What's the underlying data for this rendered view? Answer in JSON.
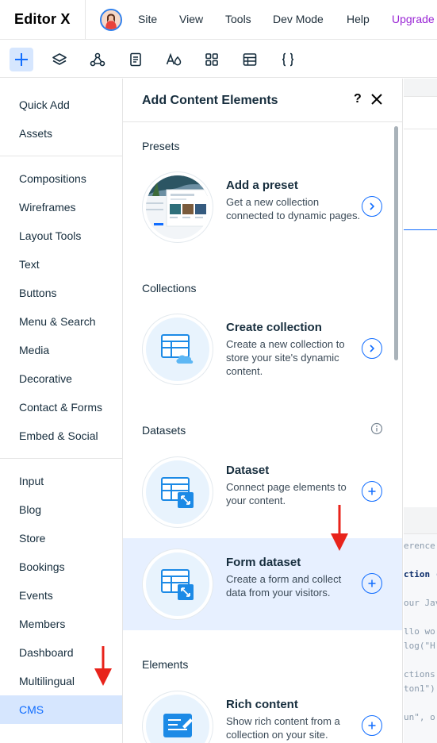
{
  "app": {
    "logo": "Editor X",
    "nav": [
      "Site",
      "View",
      "Tools",
      "Dev Mode",
      "Help",
      "Upgrade"
    ]
  },
  "toolbar": {
    "tools": [
      "add-icon",
      "layers-icon",
      "connections-icon",
      "pages-icon",
      "typography-icon",
      "apps-icon",
      "cms-table-icon",
      "code-braces-icon"
    ]
  },
  "sidebar": {
    "items": [
      "Quick Add",
      "Assets",
      "Compositions",
      "Wireframes",
      "Layout Tools",
      "Text",
      "Buttons",
      "Menu & Search",
      "Media",
      "Decorative",
      "Contact & Forms",
      "Embed & Social",
      "Input",
      "Blog",
      "Store",
      "Bookings",
      "Events",
      "Members",
      "Dashboard",
      "Multilingual",
      "CMS"
    ],
    "active": "CMS"
  },
  "panel": {
    "title": "Add Content Elements",
    "help": "?",
    "sections": {
      "presets": "Presets",
      "collections": "Collections",
      "datasets": "Datasets",
      "elements": "Elements"
    },
    "cards": [
      {
        "title": "Add a preset",
        "desc": "Get a new collection connected to dynamic pages."
      },
      {
        "title": "Create collection",
        "desc": "Create a new collection to store your site's dynamic content."
      },
      {
        "title": "Dataset",
        "desc": "Connect page elements to your content."
      },
      {
        "title": "Form dataset",
        "desc": "Create a form and collect data from your visitors."
      },
      {
        "title": "Rich content",
        "desc": "Show rich content from a collection on your site."
      }
    ]
  },
  "code_panel": {
    "lines": [
      "erence",
      "ction (",
      "our Jav",
      "llo wo",
      "log(\"H",
      "ctions",
      "ton1\")",
      "un\", o"
    ]
  },
  "colors": {
    "accent": "#116dff",
    "active_bg": "#d6e6fe",
    "hover_bg": "#e7f0ff",
    "upgrade": "#9a27d5",
    "arrow": "#e8231b"
  }
}
